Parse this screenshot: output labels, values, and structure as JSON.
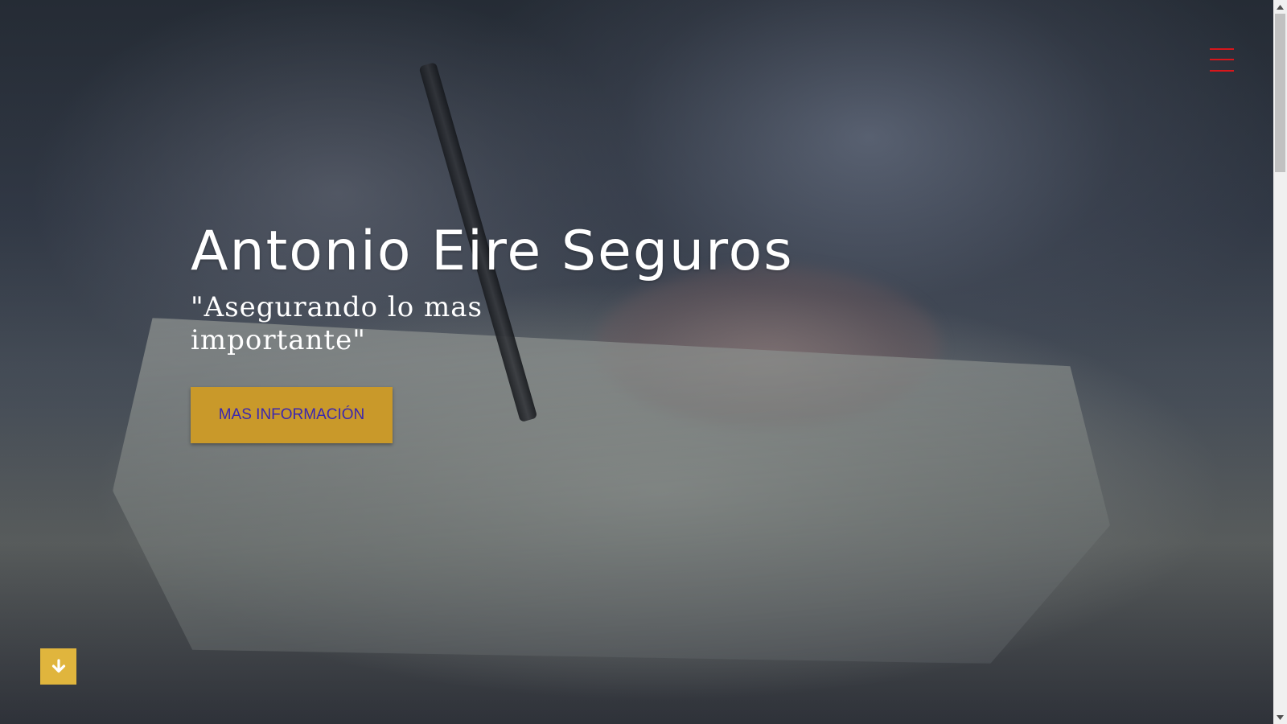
{
  "hero": {
    "title": "Antonio Eire Seguros",
    "tagline": "\"Asegurando lo mas importante\"",
    "cta_label": "MAS INFORMACIÓN"
  },
  "nav": {
    "menu_icon": "hamburger-menu-icon"
  },
  "scroll_down": {
    "icon": "arrow-down-icon"
  },
  "colors": {
    "accent": "#c9992a",
    "cta_text": "#3b27b0",
    "menu_icon": "#d8161b",
    "scroll_button": "#e0b53d"
  }
}
